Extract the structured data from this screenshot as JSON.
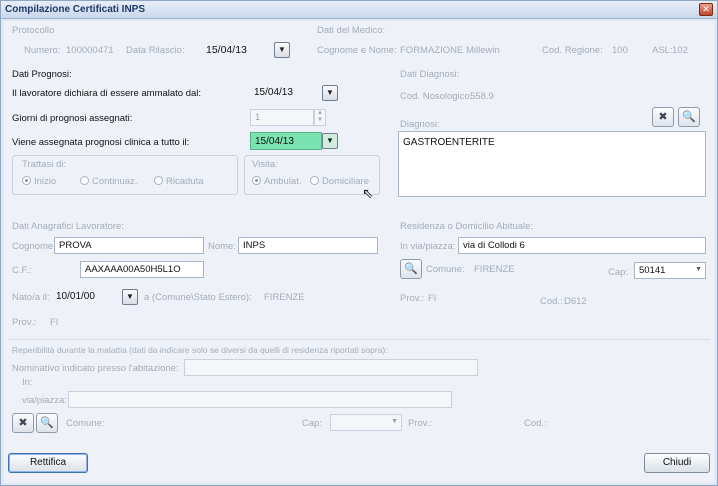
{
  "window": {
    "title": "Compilazione Certificati INPS",
    "close_glyph": "✕"
  },
  "protocollo": {
    "group_label": "Protocollo",
    "numero_label": "Numero:",
    "numero_value": "100000471",
    "data_rilascio_label": "Data Rilascio:",
    "data_rilascio_value": "15/04/13"
  },
  "medico": {
    "group_label": "Dati del Medico:",
    "cognome_label": "Cognome e Nome:",
    "cognome_value": "FORMAZIONE Millewin",
    "regione_label": "Cod. Regione:",
    "regione_value": "100",
    "asl_label": "ASL:",
    "asl_value": "102"
  },
  "prognosi": {
    "group_label": "Dati Prognosi:",
    "ammalato_label": "Il lavoratore dichiara di essere ammalato dal:",
    "ammalato_value": "15/04/13",
    "giorni_label": "Giorni di prognosi assegnati:",
    "giorni_value": "1",
    "clinica_label": "Viene assegnata prognosi clinica a tutto il:",
    "clinica_value": "15/04/13",
    "trattasi_label": "Trattasi di:",
    "trattasi_options": [
      "Inizio",
      "Continuaz.",
      "Ricaduta"
    ],
    "visita_label": "Visita:",
    "visita_options": [
      "Ambulat.",
      "Domiciliare"
    ]
  },
  "diagnosi": {
    "group_label": "Dati Diagnosi:",
    "nosologico_label": "Cod. Nosologico:",
    "nosologico_value": "558.9",
    "diagnosi_label": "Diagnosi:",
    "diagnosi_value": "GASTROENTERITE"
  },
  "anagrafica": {
    "group_label": "Dati Anagrafici Lavoratore:",
    "cognome_label": "Cognome:",
    "cognome_value": "PROVA",
    "nome_label": "Nome:",
    "nome_value": "INPS",
    "cf_label": "C.F.:",
    "cf_value": "AAXAAA00A50H5L1O",
    "nato_label": "Nato/a il:",
    "nato_value": "10/01/00",
    "comune_nascita_label": "a (Comune\\Stato Estero):",
    "comune_nascita_value": "FIRENZE",
    "prov_label": "Prov.:",
    "prov_value": "FI"
  },
  "residenza": {
    "group_label": "Residenza o Domicilio Abituale:",
    "via_label": "In via/piazza:",
    "via_value": "via di Collodi 6",
    "comune_label": "Comune:",
    "comune_value": "FIRENZE",
    "cap_label": "Cap:",
    "cap_value": "50141",
    "prov_label": "Prov.:",
    "prov_value": "FI",
    "cod_label": "Cod.:",
    "cod_value": "D612"
  },
  "reperibilita": {
    "header": "Reperibilità durante la malattia (dati da indicare solo se diversi da quelli di residenza riportati sopra):",
    "nominativo_label": "Nominativo indicato presso l'abitazione:",
    "in_label": "In:",
    "via_label": "via/piazza:",
    "comune_label": "Comune:",
    "cap_label": "Cap:",
    "prov_label": "Prov.:",
    "cod_label": "Cod.:"
  },
  "buttons": {
    "rettifica": "Rettifica",
    "chiudi": "Chiudi"
  }
}
